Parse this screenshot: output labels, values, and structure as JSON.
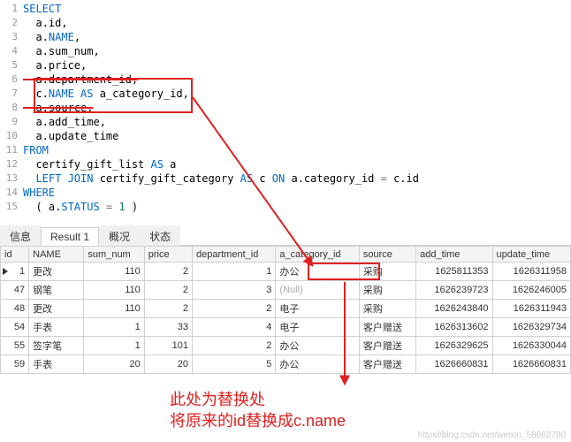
{
  "sql": {
    "lines": [
      {
        "n": "1",
        "tokens": [
          {
            "t": "SELECT",
            "c": "kw"
          }
        ]
      },
      {
        "n": "2",
        "tokens": [
          {
            "t": "  a.id,",
            "c": "id"
          }
        ]
      },
      {
        "n": "3",
        "tokens": [
          {
            "t": "  a.",
            "c": "id"
          },
          {
            "t": "NAME",
            "c": "kw"
          },
          {
            "t": ",",
            "c": "id"
          }
        ]
      },
      {
        "n": "4",
        "tokens": [
          {
            "t": "  a.sum_num,",
            "c": "id"
          }
        ]
      },
      {
        "n": "5",
        "tokens": [
          {
            "t": "  a.price,",
            "c": "id"
          }
        ]
      },
      {
        "n": "6",
        "tokens": [
          {
            "t": "  a.department_id,",
            "c": "id strike"
          }
        ]
      },
      {
        "n": "7",
        "tokens": [
          {
            "t": "  c.",
            "c": "id"
          },
          {
            "t": "NAME",
            "c": "kw"
          },
          {
            "t": " ",
            "c": "id"
          },
          {
            "t": "AS",
            "c": "kw"
          },
          {
            "t": " a_category_id,",
            "c": "id"
          }
        ]
      },
      {
        "n": "8",
        "tokens": [
          {
            "t": "  a.source,",
            "c": "id strike"
          }
        ]
      },
      {
        "n": "9",
        "tokens": [
          {
            "t": "  a.add_time,",
            "c": "id"
          }
        ]
      },
      {
        "n": "10",
        "tokens": [
          {
            "t": "  a.update_time",
            "c": "id"
          }
        ]
      },
      {
        "n": "11",
        "tokens": [
          {
            "t": "FROM",
            "c": "kw"
          }
        ]
      },
      {
        "n": "12",
        "tokens": [
          {
            "t": "  certify_gift_list ",
            "c": "id"
          },
          {
            "t": "AS",
            "c": "kw"
          },
          {
            "t": " a",
            "c": "id"
          }
        ]
      },
      {
        "n": "13",
        "tokens": [
          {
            "t": "  ",
            "c": "id"
          },
          {
            "t": "LEFT JOIN",
            "c": "kw"
          },
          {
            "t": " certify_gift_category ",
            "c": "id"
          },
          {
            "t": "AS",
            "c": "kw"
          },
          {
            "t": " c ",
            "c": "id"
          },
          {
            "t": "ON",
            "c": "kw"
          },
          {
            "t": " a.category_id ",
            "c": "id"
          },
          {
            "t": "=",
            "c": "op"
          },
          {
            "t": " c.id",
            "c": "id"
          }
        ]
      },
      {
        "n": "14",
        "tokens": [
          {
            "t": "WHERE",
            "c": "kw"
          }
        ]
      },
      {
        "n": "15",
        "tokens": [
          {
            "t": "  ( a.",
            "c": "id"
          },
          {
            "t": "STATUS",
            "c": "kw"
          },
          {
            "t": " ",
            "c": "id"
          },
          {
            "t": "=",
            "c": "op"
          },
          {
            "t": " ",
            "c": "id"
          },
          {
            "t": "1",
            "c": "num"
          },
          {
            "t": " )",
            "c": "id"
          }
        ]
      }
    ]
  },
  "tabs": {
    "items": [
      "信息",
      "Result 1",
      "概况",
      "状态"
    ],
    "active": 1
  },
  "table": {
    "columns": [
      "id",
      "NAME",
      "sum_num",
      "price",
      "department_id",
      "a_category_id",
      "source",
      "add_time",
      "update_time"
    ],
    "rows": [
      {
        "id": "1",
        "name": "更改",
        "sum": "110",
        "price": "2",
        "dept": "1",
        "cat": "办公",
        "src": "采购",
        "add": "1625811353",
        "upd": "1626311958",
        "arrow": true
      },
      {
        "id": "47",
        "name": "钢笔",
        "sum": "110",
        "price": "2",
        "dept": "3",
        "cat": "(Null)",
        "src": "采购",
        "add": "1626239723",
        "upd": "1626246005"
      },
      {
        "id": "48",
        "name": "更改",
        "sum": "110",
        "price": "2",
        "dept": "2",
        "cat": "电子",
        "src": "采购",
        "add": "1626243840",
        "upd": "1626311943"
      },
      {
        "id": "54",
        "name": "手表",
        "sum": "1",
        "price": "33",
        "dept": "4",
        "cat": "电子",
        "src": "客户赠送",
        "add": "1626313602",
        "upd": "1626329734"
      },
      {
        "id": "55",
        "name": "签字笔",
        "sum": "1",
        "price": "101",
        "dept": "2",
        "cat": "办公",
        "src": "客户赠送",
        "add": "1626329625",
        "upd": "1626330044"
      },
      {
        "id": "59",
        "name": "手表",
        "sum": "20",
        "price": "20",
        "dept": "5",
        "cat": "办公",
        "src": "客户赠送",
        "add": "1626660831",
        "upd": "1626660831"
      }
    ]
  },
  "annotation": {
    "line1": "此处为替换处",
    "line2": "将原来的id替换成c.name"
  },
  "watermark": "https//blog.csdn.net/weixin_58662780"
}
